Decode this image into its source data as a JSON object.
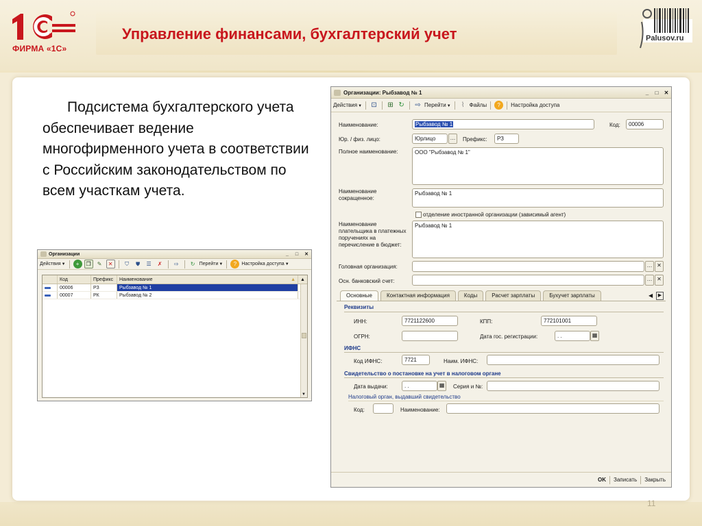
{
  "slide": {
    "title": "Управление финансами, бухгалтерский учет",
    "logo_text": "ФИРМА «1С»",
    "partner_text": "Palusov.ru",
    "body": "Подсистема бухгалтерского учета обеспечивает ведение многофирменного учета в соответствии с Российским законодательством по всем участкам учета.",
    "page_number": "11"
  },
  "colors": {
    "brand_red": "#c8161d",
    "selection_blue": "#1f3fa3",
    "window_bg": "#f4f1e7"
  },
  "list_window": {
    "title": "Организации",
    "toolbar": {
      "actions": "Действия",
      "goto": "Перейти",
      "access": "Настройка доступа"
    },
    "columns": [
      "Код",
      "Префикс",
      "Наименование"
    ],
    "rows": [
      {
        "code": "00006",
        "prefix": "РЗ",
        "name": "Рыбзавод № 1",
        "selected": true
      },
      {
        "code": "00007",
        "prefix": "РК",
        "name": "Рыбзавод № 2",
        "selected": false
      }
    ]
  },
  "form_window": {
    "title": "Организации: Рыбзавод № 1",
    "toolbar": {
      "actions": "Действия",
      "goto": "Перейти",
      "files": "Файлы",
      "access": "Настройка доступа"
    },
    "fields": {
      "name_label": "Наименование:",
      "name_value": "Рыбзавод № 1",
      "code_label": "Код:",
      "code_value": "00006",
      "legal_label": "Юр. / физ. лицо:",
      "legal_value": "Юрлицо",
      "prefix_label": "Префикс:",
      "prefix_value": "РЗ",
      "full_name_label": "Полное наименование:",
      "full_name_value": "ООО \"Рыбзавод № 1\"",
      "short_name_label": "Наименование сокращенное:",
      "short_name_value": "Рыбзавод № 1",
      "foreign_branch_label": "отделение иностранной организации (зависимый агент)",
      "payer_name_label": "Наименование плательщика в платежных поручениях на перечисление в бюджет:",
      "payer_name_value": "Рыбзавод № 1",
      "head_org_label": "Головная организация:",
      "bank_account_label": "Осн. банковский счет:"
    },
    "tabs": [
      "Основные",
      "Контактная информация",
      "Коды",
      "Расчет зарплаты",
      "Бухучет зарплаты"
    ],
    "requisites": {
      "section": "Реквизиты",
      "inn_label": "ИНН:",
      "inn_value": "7721122600",
      "kpp_label": "КПП:",
      "kpp_value": "772101001",
      "ogrn_label": "ОГРН:",
      "reg_date_label": "Дата гос. регистрации:",
      "reg_date_value": " .  . "
    },
    "ifns": {
      "section": "ИФНС",
      "code_label": "Код ИФНС:",
      "code_value": "7721",
      "name_label": "Наим. ИФНС:"
    },
    "certificate": {
      "section": "Свидетельство о постановке на учет в налоговом органе",
      "issue_date_label": "Дата выдачи:",
      "issue_date_value": " .  . ",
      "series_label": "Серия и №:",
      "authority_group": "Налоговый орган, выдавший свидетельство",
      "code_label": "Код:",
      "name_label": "Наименование:"
    },
    "buttons": {
      "ok": "OK",
      "save": "Записать",
      "close": "Закрыть"
    }
  }
}
